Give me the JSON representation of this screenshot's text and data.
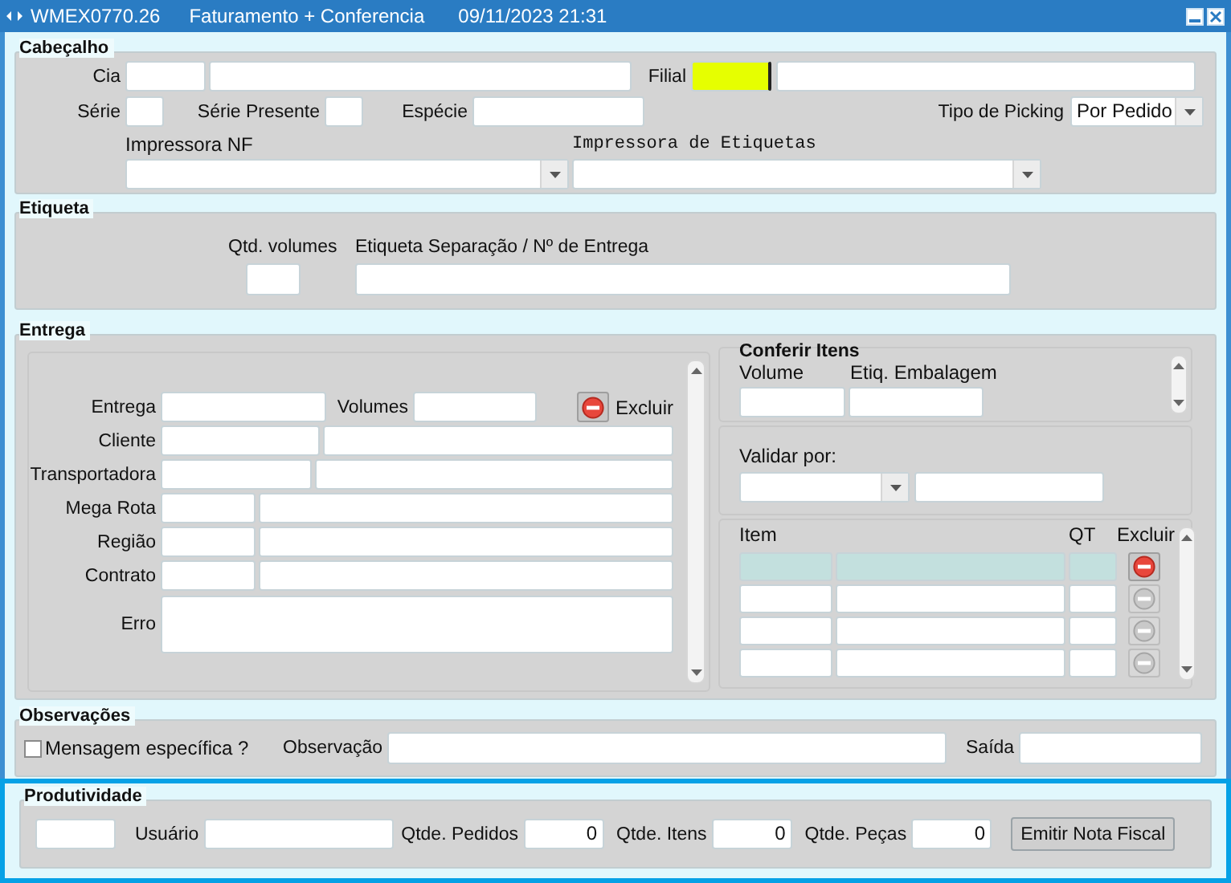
{
  "window": {
    "code": "WMEX0770.26",
    "title": "Faturamento + Conferencia",
    "datetime": "09/11/2023 21:31"
  },
  "cabecalho": {
    "title": "Cabeçalho",
    "cia_label": "Cia",
    "filial_label": "Filial",
    "filial_focused": true,
    "serie_label": "Série",
    "serie_presente_label": "Série Presente",
    "especie_label": "Espécie",
    "tipo_picking_label": "Tipo de Picking",
    "tipo_picking_value": "Por Pedido",
    "impressora_nf_label": "Impressora NF",
    "impressora_etiquetas_label": "Impressora de Etiquetas"
  },
  "etiqueta": {
    "title": "Etiqueta",
    "qtd_volumes_label": "Qtd. volumes",
    "separacao_label": "Etiqueta Separação / Nº de Entrega"
  },
  "entrega": {
    "title": "Entrega",
    "entrega_label": "Entrega",
    "volumes_label": "Volumes",
    "excluir_label": "Excluir",
    "cliente_label": "Cliente",
    "transportadora_label": "Transportadora",
    "mega_rota_label": "Mega Rota",
    "regiao_label": "Região",
    "contrato_label": "Contrato",
    "erro_label": "Erro"
  },
  "conferir": {
    "title": "Conferir Itens",
    "volume_label": "Volume",
    "etiq_label": "Etiq. Embalagem",
    "validar_label": "Validar por:",
    "columns": [
      "Item",
      "QT",
      "Excluir"
    ],
    "rows": [
      {
        "selected": true,
        "delete_enabled": true
      },
      {
        "selected": false,
        "delete_enabled": false
      },
      {
        "selected": false,
        "delete_enabled": false
      },
      {
        "selected": false,
        "delete_enabled": false
      }
    ]
  },
  "observacoes": {
    "title": "Observações",
    "checkbox_label": "Mensagem específica ?",
    "checked": false,
    "observacao_label": "Observação",
    "saida_label": "Saída"
  },
  "produtividade": {
    "title": "Produtividade",
    "focused": true,
    "usuario_label": "Usuário",
    "pedidos_label": "Qtde. Pedidos",
    "pedidos_value": "0",
    "itens_label": "Qtde. Itens",
    "itens_value": "0",
    "pecas_label": "Qtde. Peças",
    "pecas_value": "0",
    "button": "Emitir Nota Fiscal"
  }
}
